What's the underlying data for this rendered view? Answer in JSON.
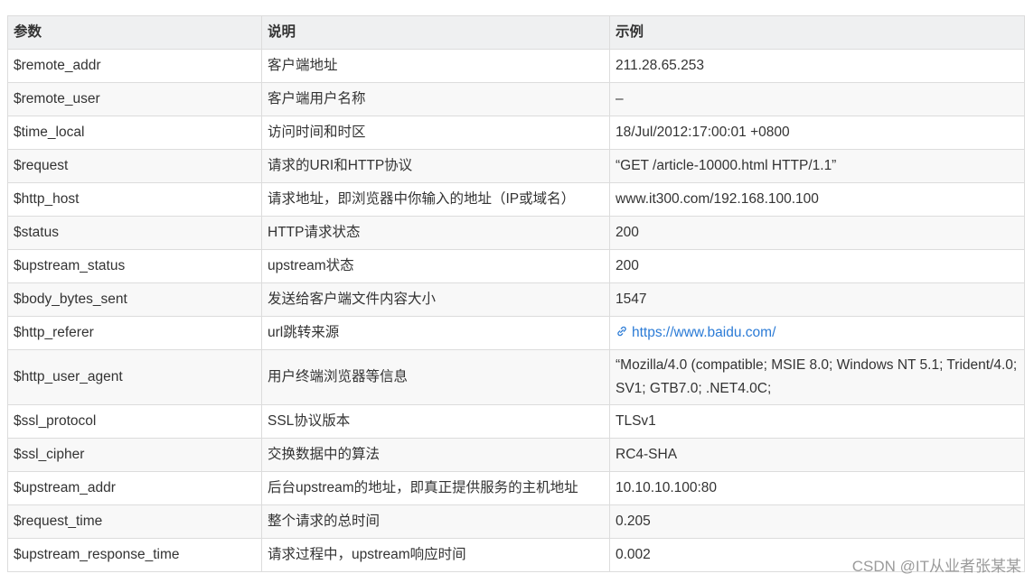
{
  "table": {
    "headers": [
      "参数",
      "说明",
      "示例"
    ],
    "rows": [
      {
        "param": "$remote_addr",
        "desc": "客户端地址",
        "example": "211.28.65.253"
      },
      {
        "param": "$remote_user",
        "desc": "客户端用户名称",
        "example": "–"
      },
      {
        "param": "$time_local",
        "desc": "访问时间和时区",
        "example": "18/Jul/2012:17:00:01 +0800"
      },
      {
        "param": "$request",
        "desc": "请求的URI和HTTP协议",
        "example": "“GET /article-10000.html HTTP/1.1”"
      },
      {
        "param": "$http_host",
        "desc": "请求地址，即浏览器中你输入的地址（IP或域名）",
        "example": "www.it300.com/192.168.100.100"
      },
      {
        "param": "$status",
        "desc": "HTTP请求状态",
        "example": "200"
      },
      {
        "param": "$upstream_status",
        "desc": "upstream状态",
        "example": "200"
      },
      {
        "param": "$body_bytes_sent",
        "desc": "发送给客户端文件内容大小",
        "example": "1547"
      },
      {
        "param": "$http_referer",
        "desc": "url跳转来源",
        "example": "https://www.baidu.com/"
      },
      {
        "param": "$http_user_agent",
        "desc": "用户终端浏览器等信息",
        "example": "“Mozilla/4.0 (compatible; MSIE 8.0; Windows NT 5.1; Trident/4.0; SV1; GTB7.0; .NET4.0C;"
      },
      {
        "param": "$ssl_protocol",
        "desc": "SSL协议版本",
        "example": "TLSv1"
      },
      {
        "param": "$ssl_cipher",
        "desc": "交换数据中的算法",
        "example": "RC4-SHA"
      },
      {
        "param": "$upstream_addr",
        "desc": "后台upstream的地址，即真正提供服务的主机地址",
        "example": "10.10.10.100:80"
      },
      {
        "param": "$request_time",
        "desc": "整个请求的总时间",
        "example": "0.205"
      },
      {
        "param": "$upstream_response_time",
        "desc": "请求过程中，upstream响应时间",
        "example": "0.002"
      }
    ]
  },
  "watermark": "CSDN @IT从业者张某某",
  "colors": {
    "link": "#2b7bd6",
    "header_bg": "#eff0f1",
    "border": "#dcdcdc"
  },
  "icons": {
    "link_icon": "link-icon"
  }
}
